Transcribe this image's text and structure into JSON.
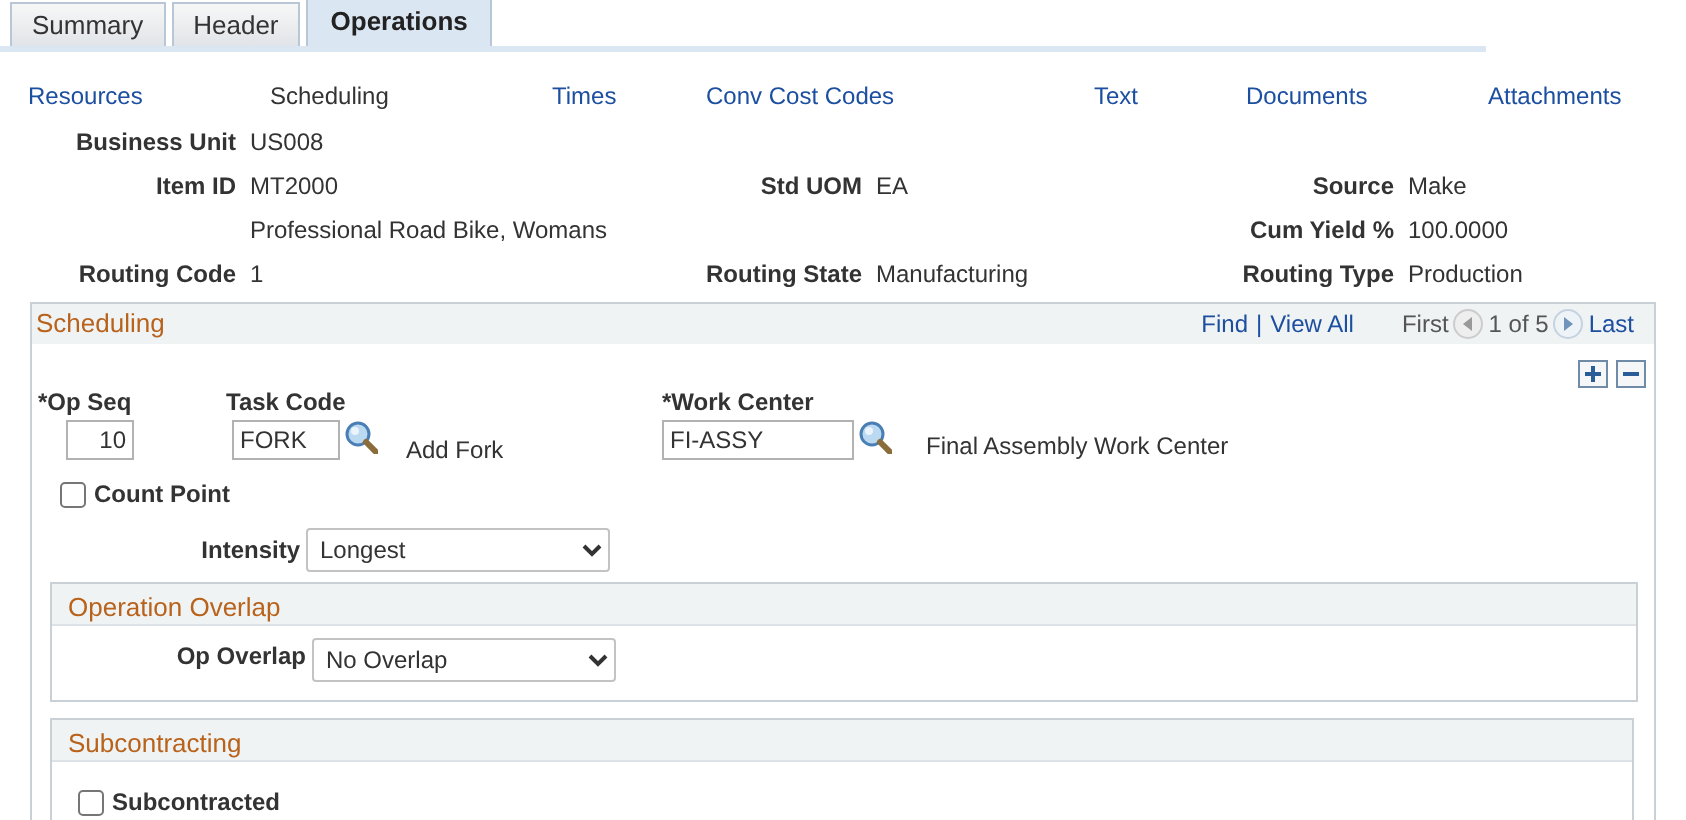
{
  "tabs": [
    {
      "label": "Summary",
      "selected": false
    },
    {
      "label": "Header",
      "selected": false
    },
    {
      "label": "Operations",
      "selected": true
    }
  ],
  "links": [
    {
      "label": "Resources",
      "selected": false
    },
    {
      "label": "Scheduling",
      "selected": true
    },
    {
      "label": "Times",
      "selected": false
    },
    {
      "label": "Conv Cost Codes",
      "selected": false
    },
    {
      "label": "Text",
      "selected": false
    },
    {
      "label": "Documents",
      "selected": false
    },
    {
      "label": "Attachments",
      "selected": false
    }
  ],
  "header_rows": [
    {
      "left": {
        "label": "Business Unit",
        "value": "US008"
      }
    },
    {
      "left": {
        "label": "Item ID",
        "value": "MT2000"
      },
      "middle": {
        "label": "Std UOM",
        "value": "EA"
      },
      "right": {
        "label": "Source",
        "value": "Make"
      }
    },
    {
      "left": {
        "value": "Professional Road Bike, Womans"
      },
      "right": {
        "label": "Cum Yield %",
        "value": "100.0000"
      }
    },
    {
      "left": {
        "label": "Routing Code",
        "value": "1"
      },
      "middle": {
        "label": "Routing State",
        "value": "Manufacturing"
      },
      "right": {
        "label": "Routing Type",
        "value": "Production"
      }
    }
  ],
  "scheduling": {
    "title": "Scheduling",
    "find": "Find",
    "separator": "|",
    "view_all": "View All",
    "first": "First",
    "position": "1 of 5",
    "last": "Last",
    "op_seq": {
      "label": "*Op Seq",
      "value": "10"
    },
    "task_code": {
      "label": "Task Code",
      "value": "FORK",
      "description": "Add Fork"
    },
    "work_center": {
      "label": "*Work Center",
      "value": "FI-ASSY",
      "description": "Final Assembly Work Center"
    },
    "count_point": {
      "label": "Count Point",
      "checked": false
    },
    "intensity": {
      "label": "Intensity",
      "value": "Longest"
    },
    "operation_overlap": {
      "title": "Operation Overlap",
      "op_overlap": {
        "label": "Op Overlap",
        "value": "No Overlap"
      }
    },
    "subcontracting": {
      "title": "Subcontracting",
      "subcontracted": {
        "label": "Subcontracted",
        "checked": false
      }
    }
  }
}
